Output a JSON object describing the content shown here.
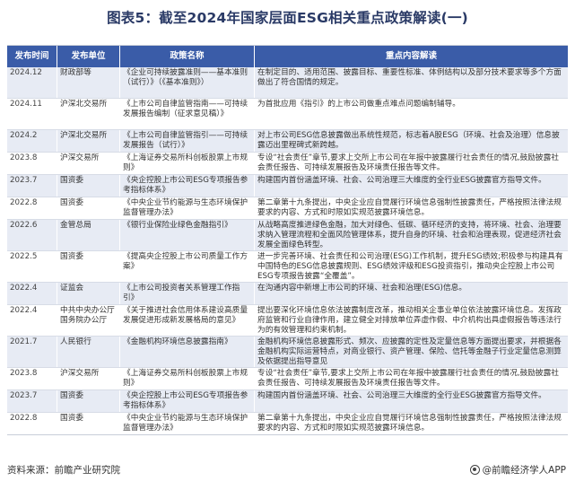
{
  "title": "图表5：截至2024年国家层面ESG相关重点政策解读(一)",
  "table": {
    "headers": [
      "发布时间",
      "发布单位",
      "政策名称",
      "重点内容解读"
    ],
    "rows": [
      {
        "date": "2024.12",
        "org": "财政部等",
        "policy": "《企业可持续披露准则——基本准则（试行）》（《基本准则》）",
        "content": "在制定目的、适用范围、披露目标、重要性标准、体例结构以及部分技术要求等多个方面做出了符合国情的规定。",
        "h": 34
      },
      {
        "date": "2024.11",
        "org": "沪深北交易所",
        "policy": "《上市公司自律监管指南——可持续发展报告编制（征求意见稿）》",
        "content": "为首批应用《指引》的上市公司做重点难点问题编制辅导。",
        "h": 34
      },
      {
        "date": "2024.2",
        "org": "沪深北交易所",
        "policy": "《上市公司自律监管指引——可持续发展报告（试行）》",
        "content": "对上市公司ESG信息披露做出系统性规范，标志着A股ESG（环境、社会及治理）信息披露迈出里程碑式新跨越。",
        "h": 24
      },
      {
        "date": "2023.8",
        "org": "沪深交易所",
        "policy": "《上海证券交易所科创板股票上市规则》",
        "content": "专设“社会责任”章节,要求上交所上市公司在年报中披露履行社会责任的情况,鼓励披露社会责任报告、可持续发展报告及环境责任报告等文件。",
        "h": 24
      },
      {
        "date": "2023.7",
        "org": "国资委",
        "policy": "《央企控股上市公司ESG专项报告参考指标体系》",
        "content": "构建国内首份涵盖环境、社会、公司治理三大维度的全行业ESG披露官方指导文件。",
        "h": 24
      },
      {
        "date": "2022.8",
        "org": "国资委",
        "policy": "《中央企业节约能源与生态环境保护监督管理办法》",
        "content": "第二章第十九条提出，中央企业应自觉履行环境信息强制性披露责任，严格按照法律法规要求的内容、方式和时限如实规范披露环境信息。",
        "h": 24
      },
      {
        "date": "2022.6",
        "org": "金管总局",
        "policy": "《银行业保险业绿色金融指引》",
        "content": "从战略高度推进绿色金融，加大对绿色、低碳、循环经济的支持，将环境、社会、治理要求纳入管理流程和全面风险管理体系，提升自身的环境、社会和治理表现，促进经济社会发展全面绿色转型。",
        "h": 34
      },
      {
        "date": "2022.5",
        "org": "国资委",
        "policy": "《提高央企控股上市公司质量工作方案》",
        "content": "进一步完善环境、社会责任和公司治理(ESG)工作机制，提升ESG绩效;积极参与构建具有中国特色的ESG信息披露规则、ESG绩效评级和ESG投资指引，推动央企控股上市公司ESG专项报告披露“全覆盖”。",
        "h": 34
      },
      {
        "date": "2022.4",
        "org": "证监会",
        "policy": "《上市公司投资者关系管理工作指引》",
        "content": "在沟通内容中新增上市公司的环境、社会和治理(ESG)信息。",
        "h": 24
      },
      {
        "date": "2022.4",
        "org": "中共中央办公厅国务院办公厅",
        "policy": "《关于推进社会信用体系建设高质量发展促进形成新发展格局的意见》",
        "content": "提出要深化环境信息依法披露制度改革，推动相关企事业单位依法披露环境信息。发挥政府监管和行业自律作用，建立健全对排放单位弄虚作假、中介机构出具虚假报告等违法行为的有效管理和约束机制。",
        "h": 34
      },
      {
        "date": "2021.7",
        "org": "人民银行",
        "policy": "《金融机构环境信息披露指南》",
        "content": "金融机构环境信息披露形式、频次、应披露的定性及定量信息等方面提出要求，并根据各金融机构实际运营特点，对商业银行、资产管理、保险、信托等金融子行业定量信息测算及依据提出指导意见",
        "h": 34
      },
      {
        "date": "2023.8",
        "org": "沪深交易所",
        "policy": "《上海证券交易所科创板股票上市规则》",
        "content": "专设“社会责任”章节,要求上交所上市公司在年报中披露履行社会责任的情况,鼓励披露社会责任报告、可持续发展报告及环境责任报告等文件。",
        "h": 24
      },
      {
        "date": "2023.7",
        "org": "国资委",
        "policy": "《央企控股上市公司ESG专项报告参考指标体系》",
        "content": "构建国内首份涵盖环境、社会、公司治理三大维度的全行业ESG披露官方指导文件。",
        "h": 24
      },
      {
        "date": "2022.8",
        "org": "国资委",
        "policy": "《中央企业节约能源与生态环境保护监督管理办法》",
        "content": "第二章第十九条提出，中央企业应自觉履行环境信息强制性披露责任，严格按照法律法规要求的内容、方式和时限如实规范披露环境信息。",
        "h": 24
      }
    ]
  },
  "footer": {
    "source": "资料来源：前瞻产业研究院",
    "brand": "@前瞻经济学人APP",
    "brand_icon": "logo-icon"
  }
}
